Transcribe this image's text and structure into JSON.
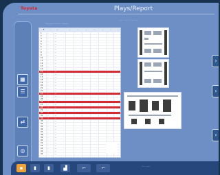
{
  "header": {
    "brand": "Toyota",
    "title": "Plays/Report",
    "status_text": ".... . .... .. . ..... ...."
  },
  "sheet": {
    "caption": "....  .......  ..  ......  ..........",
    "columns": [
      "#",
      "..",
      "....",
      "..",
      "..",
      "..",
      "...",
      "..",
      "..",
      ".."
    ],
    "rows": [
      {
        "a": "1",
        "b": "..",
        "c": "....",
        "hl": false
      },
      {
        "a": "2",
        "b": "..",
        "c": "....",
        "hl": false
      },
      {
        "a": "3",
        "b": "..",
        "c": "....",
        "hl": false
      },
      {
        "a": "4",
        "b": "..",
        "c": "....",
        "hl": false
      },
      {
        "a": "5",
        "b": "..",
        "c": "....",
        "hl": false
      },
      {
        "a": "6",
        "b": "..",
        "c": "....",
        "hl": false
      },
      {
        "a": "7",
        "b": "..",
        "c": "....",
        "hl": false
      },
      {
        "a": "8",
        "b": "..",
        "c": "....",
        "hl": false
      },
      {
        "a": "9",
        "b": "..",
        "c": "....",
        "hl": false
      },
      {
        "a": "10",
        "b": "..",
        "c": "....",
        "hl": false
      },
      {
        "a": "11",
        "b": "..",
        "c": "....",
        "hl": false
      },
      {
        "a": "12",
        "b": "..",
        "c": "....",
        "hl": false
      },
      {
        "a": "13",
        "b": "..",
        "c": "....",
        "hl": false
      },
      {
        "a": "14",
        "b": "..",
        "c": "....",
        "hl": false
      },
      {
        "a": "15",
        "b": "..",
        "c": "....",
        "hl": true
      },
      {
        "a": "16",
        "b": "..",
        "c": "....",
        "hl": false
      },
      {
        "a": "17",
        "b": "..",
        "c": "....",
        "hl": false
      },
      {
        "a": "18",
        "b": "..",
        "c": "....",
        "hl": false
      },
      {
        "a": "19",
        "b": "..",
        "c": "....",
        "hl": false
      },
      {
        "a": "20",
        "b": "..",
        "c": "....",
        "hl": false
      },
      {
        "a": "21",
        "b": "..",
        "c": "....",
        "hl": false
      },
      {
        "a": "22",
        "b": "..",
        "c": "....",
        "hl": false
      },
      {
        "a": "23",
        "b": "..",
        "c": "....",
        "hl": true
      },
      {
        "a": "24",
        "b": "..",
        "c": "....",
        "hl": false
      },
      {
        "a": "25",
        "b": "..",
        "c": "....",
        "hl": false
      },
      {
        "a": "26",
        "b": "..",
        "c": "....",
        "hl": true
      },
      {
        "a": "27",
        "b": "..",
        "c": "....",
        "hl": false
      },
      {
        "a": "28",
        "b": "..",
        "c": "....",
        "hl": true
      },
      {
        "a": "29",
        "b": "..",
        "c": "....",
        "hl": false
      },
      {
        "a": "30",
        "b": "..",
        "c": "....",
        "hl": true
      },
      {
        "a": "31",
        "b": "..",
        "c": "....",
        "hl": false
      },
      {
        "a": "32",
        "b": "..",
        "c": "....",
        "hl": true
      },
      {
        "a": "33",
        "b": "..",
        "c": "....",
        "hl": false
      },
      {
        "a": "34",
        "b": "..",
        "c": "....",
        "hl": false
      },
      {
        "a": "35",
        "b": "..",
        "c": "....",
        "hl": false
      },
      {
        "a": "36",
        "b": "..",
        "c": "....",
        "hl": false
      },
      {
        "a": "37",
        "b": "..",
        "c": "....",
        "hl": false
      },
      {
        "a": "38",
        "b": "..",
        "c": "....",
        "hl": false
      },
      {
        "a": "39",
        "b": "..",
        "c": "....",
        "hl": false
      },
      {
        "a": "40",
        "b": "..",
        "c": "....",
        "hl": false
      },
      {
        "a": "41",
        "b": "..",
        "c": "....",
        "hl": false
      },
      {
        "a": "42",
        "b": "..",
        "c": "....",
        "hl": false
      },
      {
        "a": "43",
        "b": "..",
        "c": "....",
        "hl": false
      },
      {
        "a": "44",
        "b": "..",
        "c": "....",
        "hl": false
      },
      {
        "a": "45",
        "b": "..",
        "c": "....",
        "hl": false
      }
    ],
    "note": ".... ....."
  },
  "left_panel": {
    "icons": [
      "grid-icon",
      "list-icon",
      "swap-icon",
      "gear-icon"
    ]
  },
  "right_tabs": [
    "arrow-right-icon",
    "arrow-right-icon",
    "arrow-right-icon"
  ],
  "bottom": {
    "buttons": [
      "home-icon",
      "page-icon",
      "page-icon",
      "chart-icon",
      "tool-icon",
      "tool-icon"
    ],
    "status": ".... . ......"
  }
}
